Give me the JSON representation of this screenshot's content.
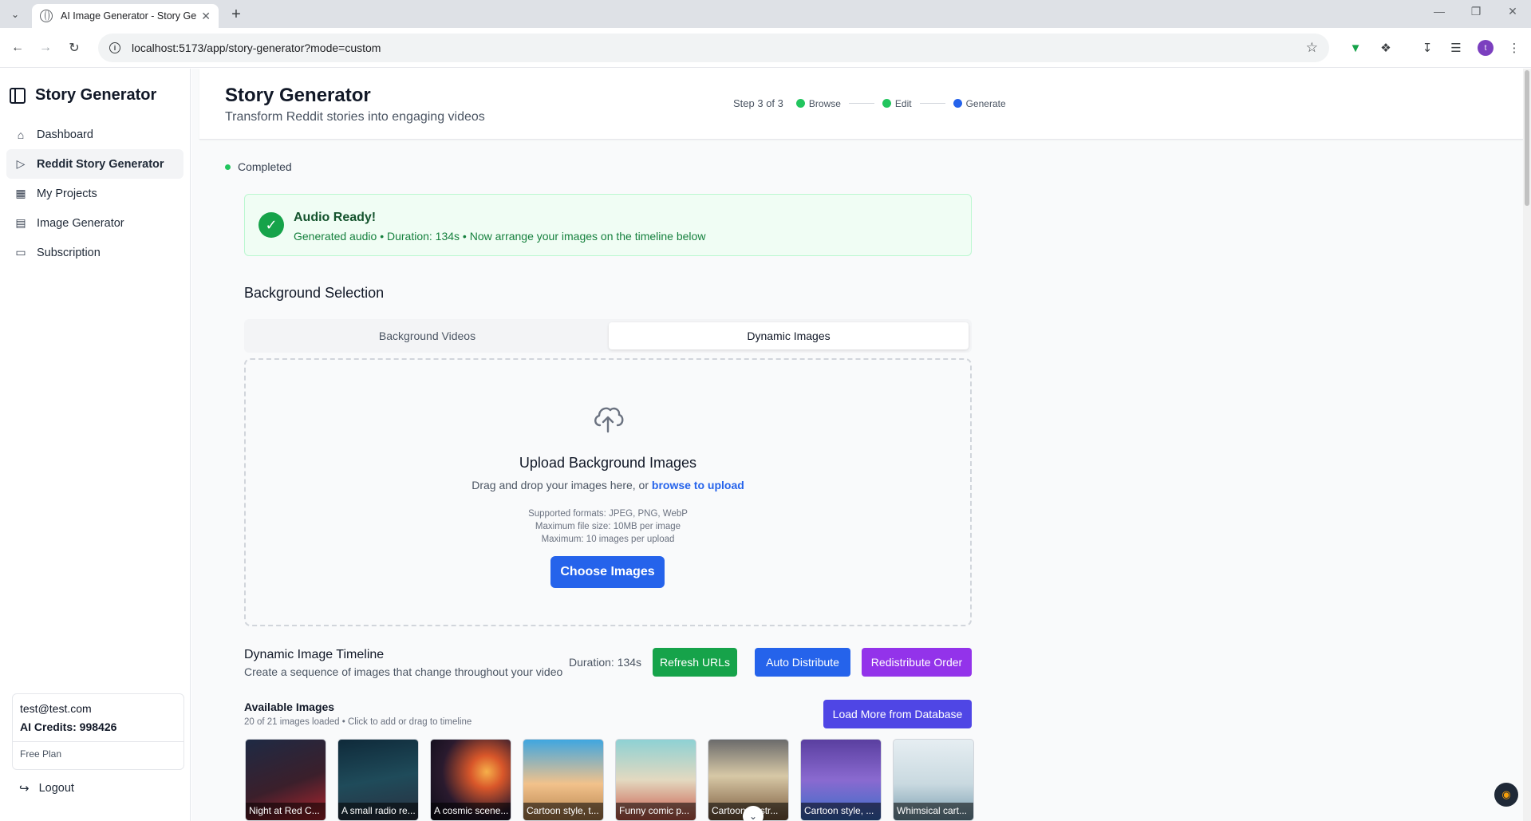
{
  "browser": {
    "tab_title": "AI Image Generator - Story Gen",
    "url": "localhost:5173/app/story-generator?mode=custom",
    "profile_initial": "t"
  },
  "sidebar": {
    "brand": "Story Generator",
    "items": [
      {
        "label": "Dashboard",
        "icon": "home-icon"
      },
      {
        "label": "Reddit Story Generator",
        "icon": "video-icon"
      },
      {
        "label": "My Projects",
        "icon": "grid-icon"
      },
      {
        "label": "Image Generator",
        "icon": "image-icon"
      },
      {
        "label": "Subscription",
        "icon": "card-icon"
      }
    ],
    "user": {
      "email": "test@test.com",
      "credits": "AI Credits: 998426",
      "plan": "Free Plan"
    },
    "logout": "Logout"
  },
  "header": {
    "title": "Story Generator",
    "subtitle": "Transform Reddit stories into engaging videos",
    "step_label": "Step 3 of 3",
    "steps": [
      {
        "name": "Browse",
        "color": "#22c55e"
      },
      {
        "name": "Edit",
        "color": "#22c55e"
      },
      {
        "name": "Generate",
        "color": "#2563eb"
      }
    ]
  },
  "status": "Completed",
  "audio": {
    "title": "Audio Ready!",
    "description": "Generated audio • Duration: 134s • Now arrange your images on the timeline below"
  },
  "background": {
    "title": "Background Selection",
    "tabs": [
      "Background Videos",
      "Dynamic Images"
    ],
    "active_tab": "Dynamic Images"
  },
  "upload": {
    "title": "Upload Background Images",
    "text_before": "Drag and drop your images here, or ",
    "link": "browse to upload",
    "formats": "Supported formats: JPEG, PNG, WebP",
    "max_size": "Maximum file size: 10MB per image",
    "max_count": "Maximum: 10 images per upload",
    "button": "Choose Images"
  },
  "timeline": {
    "title": "Dynamic Image Timeline",
    "description": "Create a sequence of images that change throughout your video",
    "duration": "Duration: 134s",
    "refresh": "Refresh URLs",
    "auto": "Auto Distribute",
    "redistribute": "Redistribute Order"
  },
  "available": {
    "title": "Available Images",
    "description": "20 of 21 images loaded • Click to add or drag to timeline",
    "load_more": "Load More from Database",
    "images": [
      {
        "caption": "Night at Red C...",
        "bg": "linear-gradient(160deg,#1e2a44 0%,#3b1f2b 55%,#b3262f 100%)"
      },
      {
        "caption": "A small radio re...",
        "bg": "linear-gradient(170deg,#0f2a3a 0%,#1f4b5a 50%,#2a3040 100%)"
      },
      {
        "caption": "A cosmic scene...",
        "bg": "radial-gradient(circle at 70% 40%,#f6b04a 0%,#d9572a 22%,#2a1a2e 60%,#0c0c18 100%)"
      },
      {
        "caption": "Cartoon style, t...",
        "bg": "linear-gradient(180deg,#3fa6e0 0%,#f2c28b 55%,#b6834e 100%)"
      },
      {
        "caption": "Funny comic p...",
        "bg": "linear-gradient(180deg,#8ed1d4 0%,#e3d9c0 50%,#c95a4b 100%)"
      },
      {
        "caption": "Cartoon illustr...",
        "bg": "linear-gradient(180deg,#6b6b6b 0%,#d7c8a6 45%,#7a5a3c 100%)"
      },
      {
        "caption": "Cartoon style, ...",
        "bg": "linear-gradient(180deg,#5a3fa0 0%,#8a6ad0 50%,#3a6ec8 100%)"
      },
      {
        "caption": "Whimsical cart...",
        "bg": "linear-gradient(180deg,#e6eef2 0%,#c9d9e0 55%,#7a9eb0 100%)"
      }
    ]
  }
}
